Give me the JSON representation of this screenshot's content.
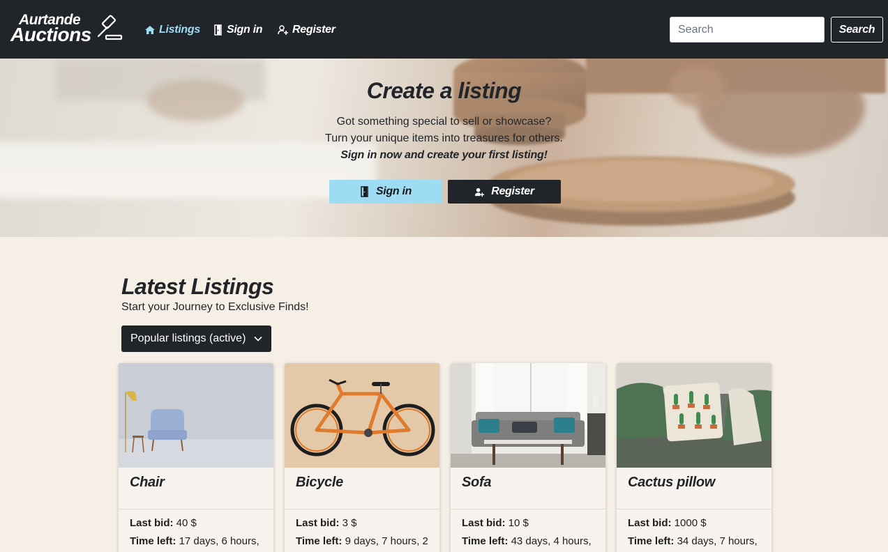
{
  "brand": {
    "line1": "Aurtande",
    "line2": "Auctions"
  },
  "nav": [
    {
      "label": "Listings",
      "icon": "home-icon",
      "active": true
    },
    {
      "label": "Sign in",
      "icon": "door-icon",
      "active": false
    },
    {
      "label": "Register",
      "icon": "user-add-icon",
      "active": false
    }
  ],
  "search": {
    "placeholder": "Search",
    "value": "",
    "button": "Search"
  },
  "hero": {
    "title": "Create a listing",
    "line1": "Got something special to sell or showcase?",
    "line2": "Turn your unique items into treasures for others.",
    "line3": "Sign in now and create your first listing!",
    "signin_label": "Sign in",
    "register_label": "Register"
  },
  "latest": {
    "title": "Latest Listings",
    "subtitle": "Start your Journey to Exclusive Finds!",
    "filter": "Popular listings (active)"
  },
  "listings": [
    {
      "title": "Chair",
      "bid_label": "Last bid:",
      "bid": "40 $",
      "time_label": "Time left:",
      "time": "17 days, 6 hours,"
    },
    {
      "title": "Bicycle",
      "bid_label": "Last bid:",
      "bid": "3 $",
      "time_label": "Time left:",
      "time": "9 days, 7 hours, 2"
    },
    {
      "title": "Sofa",
      "bid_label": "Last bid:",
      "bid": "10 $",
      "time_label": "Time left:",
      "time": "43 days, 4 hours,"
    },
    {
      "title": "Cactus pillow",
      "bid_label": "Last bid:",
      "bid": "1000 $",
      "time_label": "Time left:",
      "time": "34 days, 7 hours,"
    }
  ],
  "colors": {
    "navbar": "#212529",
    "accent": "#9ddcf3",
    "page_bg": "#f6efe6",
    "card_bg": "#f7f3ee"
  }
}
